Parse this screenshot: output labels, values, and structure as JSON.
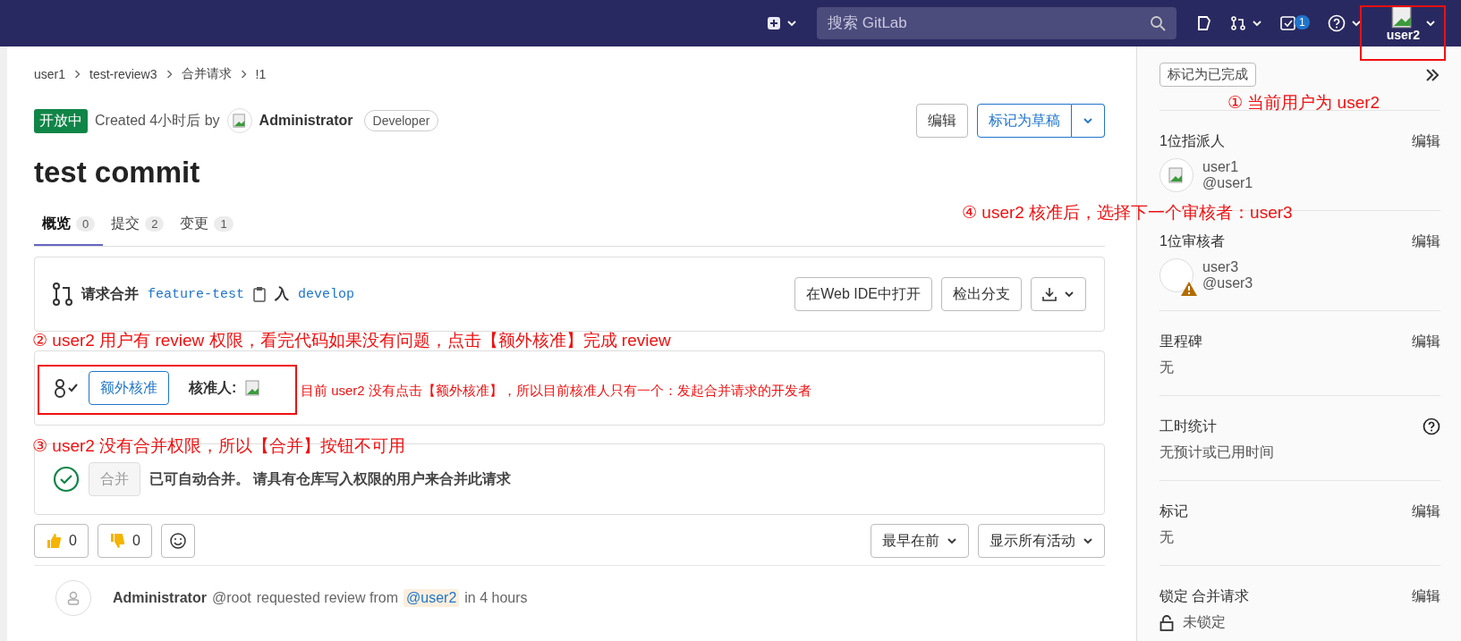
{
  "navbar": {
    "search": {
      "placeholder": "搜索 GitLab"
    },
    "todo_count": "1",
    "user": "user2"
  },
  "breadcrumb": [
    "user1",
    "test-review3",
    "合并请求",
    "!1"
  ],
  "header": {
    "status": "开放中",
    "created": "Created 4小时后 by",
    "author": "Administrator",
    "role": "Developer",
    "edit_button": "编辑",
    "draft_button": "标记为草稿"
  },
  "title": "test commit",
  "tabs": [
    {
      "label": "概览",
      "count": "0",
      "selected": true
    },
    {
      "label": "提交",
      "count": "2",
      "selected": false
    },
    {
      "label": "变更",
      "count": "1",
      "selected": false
    }
  ],
  "branch": {
    "label": "请求合并",
    "source": "feature-test",
    "into": "入",
    "target": "develop",
    "buttons": [
      "在Web IDE中打开",
      "检出分支"
    ]
  },
  "approval": {
    "button": "额外核准",
    "label": "核准人:"
  },
  "merge": {
    "button": "合并",
    "disabled": true,
    "text": "已可自动合并。 请具有仓库写入权限的用户来合并此请求"
  },
  "reactions": [
    {
      "kind": "up",
      "count": "0"
    },
    {
      "kind": "down",
      "count": "0"
    }
  ],
  "sort": "最早在前",
  "filter": "显示所有活动",
  "activity": {
    "author": "Administrator",
    "handle": "@root",
    "text": "requested review from",
    "mention": "@user2",
    "time": "in 4 hours"
  },
  "sidebar": {
    "todo_button": "标记为已完成",
    "sections": [
      {
        "kind": "people",
        "title": "1位指派人",
        "action": "编辑",
        "name": "user1",
        "handle": "@user1",
        "warning": false
      },
      {
        "kind": "people",
        "title": "1位审核者",
        "action": "编辑",
        "name": "user3",
        "handle": "@user3",
        "warning": true
      },
      {
        "kind": "value",
        "title": "里程碑",
        "action": "编辑",
        "value": "无"
      },
      {
        "kind": "help",
        "title": "工时统计",
        "value": "无预计或已用时间"
      },
      {
        "kind": "value",
        "title": "标记",
        "action": "编辑",
        "value": "无"
      },
      {
        "kind": "lock",
        "title": "锁定 合并请求",
        "action": "编辑",
        "value": "未锁定"
      }
    ]
  },
  "annotations": [
    {
      "kind": "user",
      "text": "① 当前用户为 user2"
    },
    {
      "kind": "review",
      "text": "② user2 用户有 review 权限，看完代码如果没有问题，点击【额外核准】完成 review"
    },
    {
      "kind": "approver",
      "text": "目前 user2 没有点击【额外核准】，所以目前核准人只有一个：发起合并请求的开发者"
    },
    {
      "kind": "merge",
      "text": "③ user2 没有合并权限，所以【合并】按钮不可用"
    },
    {
      "kind": "next",
      "text": "④ user2 核准后，选择下一个审核者：user3"
    }
  ]
}
